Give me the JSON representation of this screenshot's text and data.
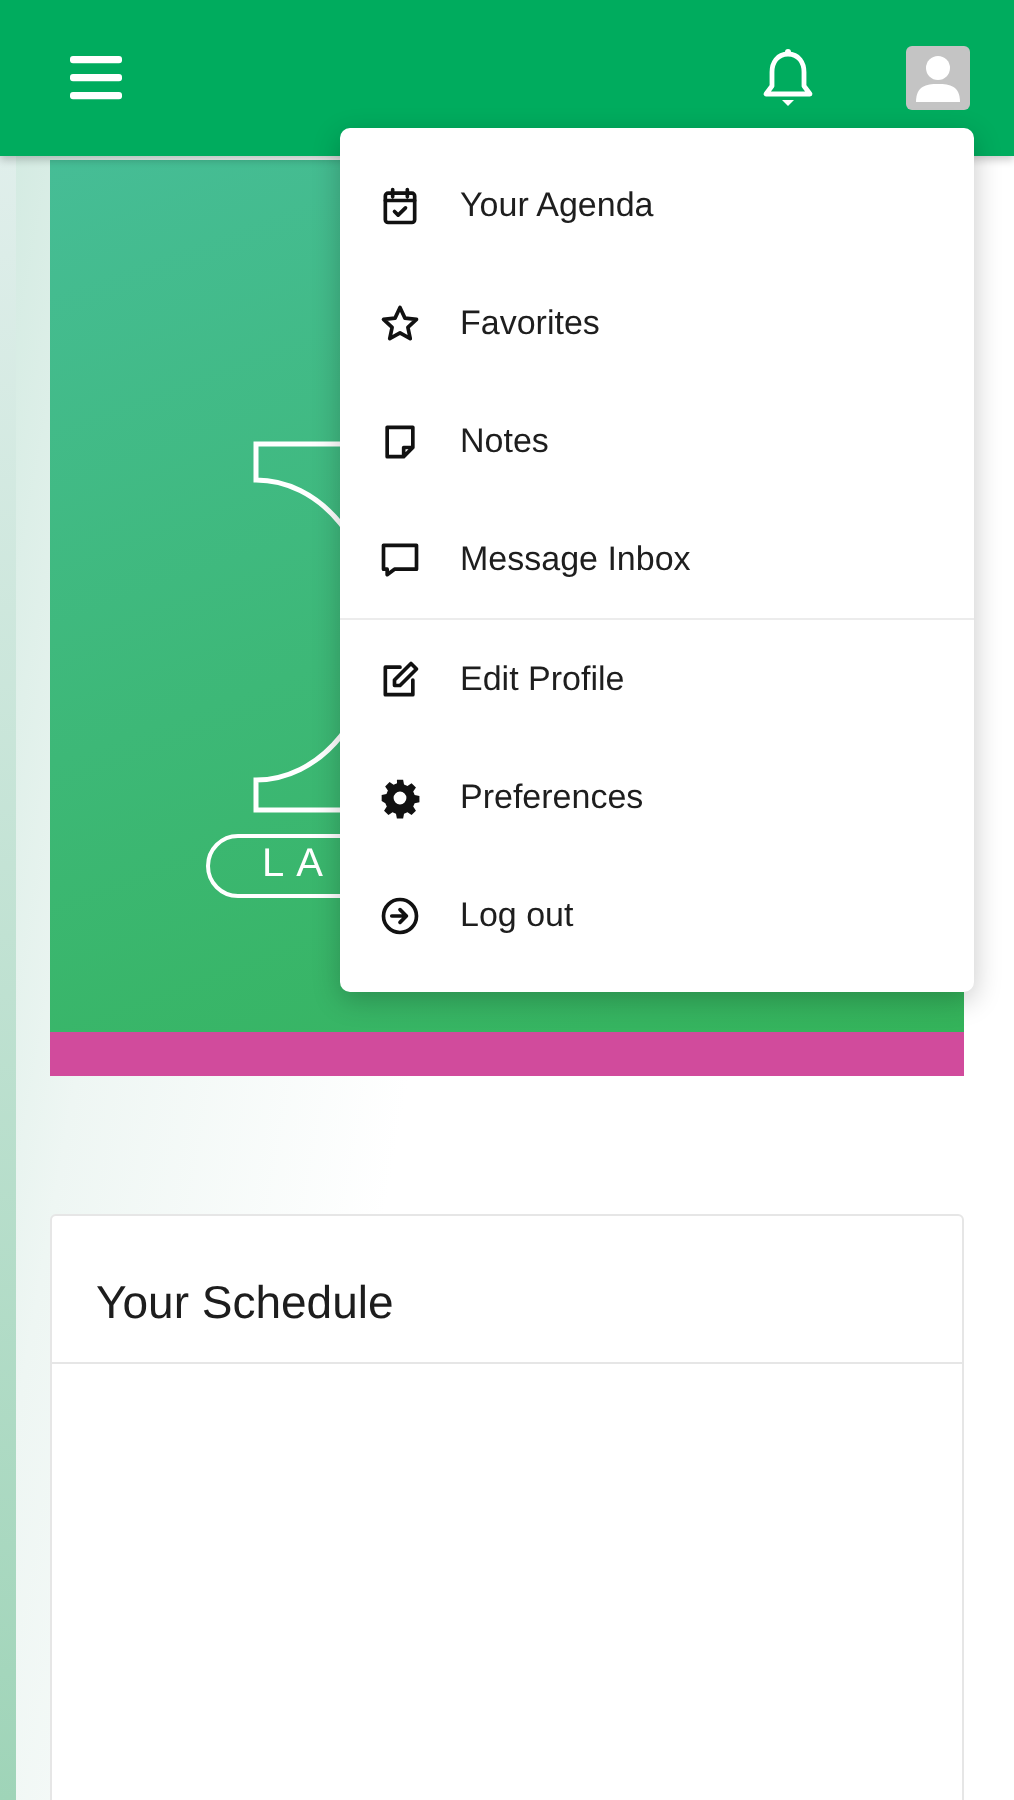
{
  "banner": {
    "logo_text": "LA"
  },
  "menu": {
    "groups": [
      [
        {
          "label": "Your Agenda"
        },
        {
          "label": "Favorites"
        },
        {
          "label": "Notes"
        },
        {
          "label": "Message Inbox"
        }
      ],
      [
        {
          "label": "Edit Profile"
        },
        {
          "label": "Preferences"
        },
        {
          "label": "Log out"
        }
      ]
    ]
  },
  "schedule": {
    "title": "Your Schedule"
  }
}
